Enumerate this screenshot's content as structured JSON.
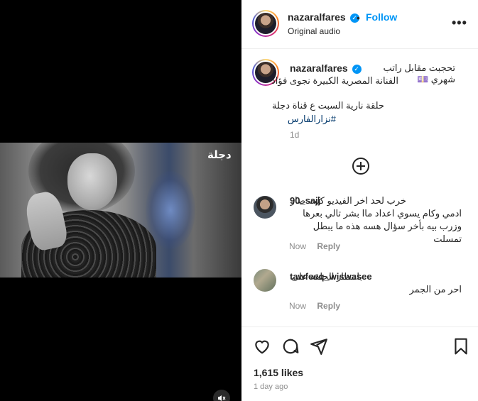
{
  "post": {
    "username": "nazaralfares",
    "follow_label": "Follow",
    "audio": "Original audio",
    "more_label": "•••",
    "dot": "•",
    "verified_mark": "✓",
    "video_watermark": "دجلة",
    "caption": {
      "line1": "تحجبت مقابل راتب شهري 💷",
      "line2": "الفنانة المصرية الكبيرة نجوى فؤاد",
      "line3": "حلقة نارية السبت ع قناة دجلة",
      "hashtag": "#نزارالفارس",
      "time": "1d"
    },
    "load_more_icon": "⊕",
    "comments": [
      {
        "username": "90_sajj",
        "text": "خرب لحد اخر الفيديو كلت صار ادمي وكام يسوي اعداد ماا بشر تالي بعرها وزرب بيه بأخر سؤال هسه هذه ما يبطل تمسلت",
        "time": "Now",
        "reply": "Reply"
      },
      {
        "username": "tawfeeq_wiswasee",
        "text": "بانتظار الحلقة على احر من الجمر",
        "time": "Now",
        "reply": "Reply"
      }
    ],
    "likes": "1,615 likes",
    "date": "1 day ago"
  },
  "icons": {
    "like": "heart-icon",
    "comment": "comment-icon",
    "share": "share-icon",
    "save": "bookmark-icon",
    "mute": "mute-icon",
    "verified": "verified-badge-icon"
  },
  "colors": {
    "accent": "#0095f6",
    "text": "#262626",
    "muted": "#8e8e8e",
    "hashtag": "#00376b"
  }
}
